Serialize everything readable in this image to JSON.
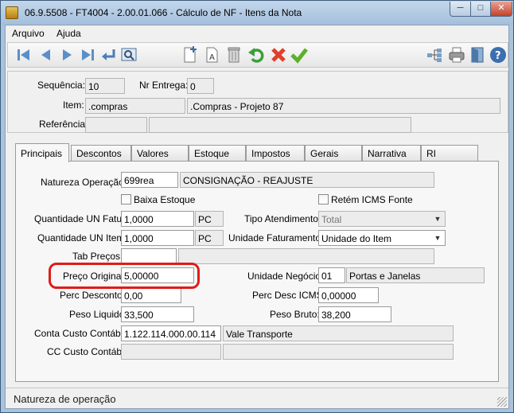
{
  "window": {
    "title": "06.9.5508 - FT4004 - 2.00.01.066 - Cálculo de NF - Itens da Nota",
    "min_label": "─",
    "max_label": "□",
    "close_label": "✕"
  },
  "menu": {
    "items": [
      {
        "label": "Arquivo"
      },
      {
        "label": "Ajuda"
      }
    ]
  },
  "toolbar": {
    "buttons": [
      "first-record",
      "previous-record",
      "next-record",
      "last-record",
      "go-to",
      "search",
      "new",
      "copy",
      "delete",
      "undo",
      "cancel",
      "confirm",
      "tree",
      "print",
      "exit",
      "help"
    ]
  },
  "header": {
    "sequencia_label": "Sequência:",
    "sequencia_value": "10",
    "nr_entrega_label": "Nr Entrega:",
    "nr_entrega_value": "0",
    "item_label": "Item:",
    "item_code": ".compras",
    "item_desc": ".Compras - Projeto 87",
    "referencia_label": "Referência:",
    "referencia_value": "",
    "referencia_desc": ""
  },
  "tabs": [
    {
      "label": "Principais",
      "active": true
    },
    {
      "label": "Descontos"
    },
    {
      "label": "Valores"
    },
    {
      "label": "Estoque"
    },
    {
      "label": "Impostos"
    },
    {
      "label": "Gerais"
    },
    {
      "label": "Narrativa"
    },
    {
      "label": "RI"
    }
  ],
  "form": {
    "natureza_label": "Natureza Operação:",
    "natureza_code": "699rea",
    "natureza_desc": "CONSIGNAÇÃO - REAJUSTE",
    "baixa_estoque_label": "Baixa Estoque",
    "retem_icms_label": "Retém ICMS Fonte",
    "qtd_fatur_label": "Quantidade UN Fatur:",
    "qtd_fatur_value": "1,0000",
    "qtd_fatur_un": "PC",
    "tipo_atendimento_label": "Tipo Atendimento:",
    "tipo_atendimento_value": "Total",
    "qtd_item_label": "Quantidade UN Item:",
    "qtd_item_value": "1,0000",
    "qtd_item_un": "PC",
    "unidade_faturamento_label": "Unidade Faturamento:",
    "unidade_faturamento_value": "Unidade do Item",
    "tab_precos_label": "Tab Preços:",
    "tab_precos_value": "",
    "tab_precos_desc": "",
    "preco_original_label": "Preço Original:",
    "preco_original_value": "5,00000",
    "unidade_negocio_label": "Unidade Negócio:",
    "unidade_negocio_code": "01",
    "unidade_negocio_desc": "Portas e Janelas",
    "perc_desconto_label": "Perc Desconto:",
    "perc_desconto_value": "0,00",
    "perc_desc_icms_label": "Perc Desc ICMS:",
    "perc_desc_icms_value": "0,00000",
    "peso_liquido_label": "Peso Liquido:",
    "peso_liquido_value": "33,500",
    "peso_bruto_label": "Peso Bruto:",
    "peso_bruto_value": "38,200",
    "conta_custo_label": "Conta Custo Contábil:",
    "conta_custo_value": "1.122.114.000.00.114",
    "conta_custo_desc": "Vale Transporte",
    "cc_custo_label": "CC Custo Contábil:",
    "cc_custo_value": "",
    "cc_custo_desc": ""
  },
  "status": {
    "text": "Natureza de operação"
  },
  "colors": {
    "highlight": "#e01b1b",
    "frame": "#a9c3dd"
  }
}
